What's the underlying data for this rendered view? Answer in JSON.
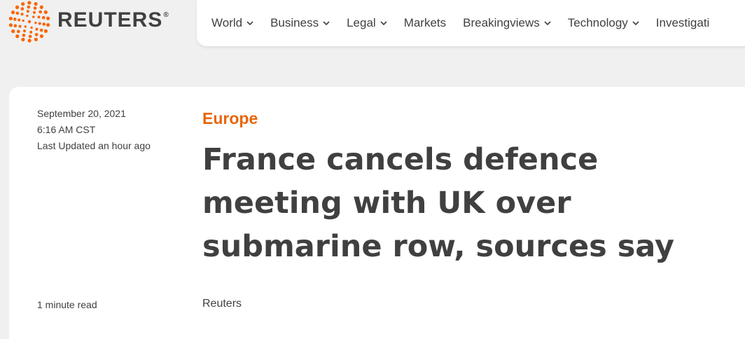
{
  "header": {
    "logo_text": "REUTERS",
    "logo_registered": "®",
    "brand_color": "#fa6400",
    "nav": [
      {
        "label": "World",
        "dropdown": true
      },
      {
        "label": "Business",
        "dropdown": true
      },
      {
        "label": "Legal",
        "dropdown": true
      },
      {
        "label": "Markets",
        "dropdown": false
      },
      {
        "label": "Breakingviews",
        "dropdown": true
      },
      {
        "label": "Technology",
        "dropdown": true
      },
      {
        "label": "Investigati",
        "dropdown": false
      }
    ]
  },
  "article": {
    "date": "September 20, 2021",
    "time": "6:16 AM CST",
    "updated": "Last Updated an hour ago",
    "read_time": "1 minute read",
    "category": "Europe",
    "category_color": "#e8650a",
    "headline": "France cancels defence meeting with UK over submarine row, sources say",
    "byline": "Reuters"
  },
  "icons": {
    "logo": "reuters-logo-icon",
    "chevron": "chevron-down-icon"
  }
}
